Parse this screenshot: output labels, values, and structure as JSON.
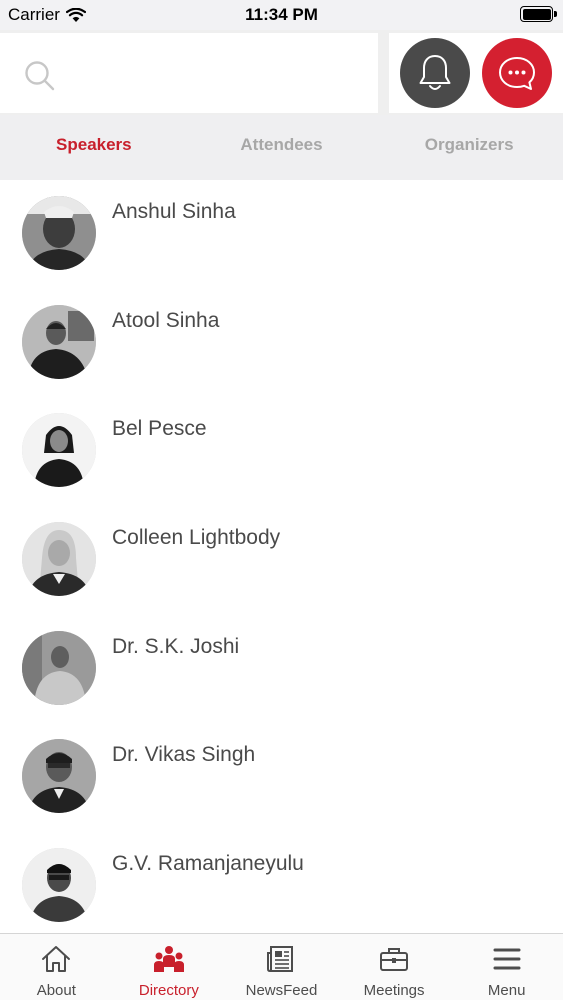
{
  "status": {
    "carrier": "Carrier",
    "time": "11:34 PM",
    "battery_level": 1.0
  },
  "search": {
    "icon": "search-icon"
  },
  "actions": {
    "notification_icon": "bell-icon",
    "chat_icon": "chat-bubble-icon",
    "accent_color": "#d42030",
    "dark_color": "#4a4a4a"
  },
  "tabs": [
    {
      "label": "Speakers",
      "active": true
    },
    {
      "label": "Attendees",
      "active": false
    },
    {
      "label": "Organizers",
      "active": false
    }
  ],
  "speakers": [
    {
      "name": "Anshul Sinha",
      "avatar": "avatar-photo"
    },
    {
      "name": "Atool Sinha",
      "avatar": "avatar-photo"
    },
    {
      "name": "Bel Pesce",
      "avatar": "avatar-photo"
    },
    {
      "name": "Colleen Lightbody",
      "avatar": "avatar-photo"
    },
    {
      "name": "Dr. S.K. Joshi",
      "avatar": "avatar-photo"
    },
    {
      "name": "Dr. Vikas Singh",
      "avatar": "avatar-photo"
    },
    {
      "name": "G.V. Ramanjaneyulu",
      "avatar": "avatar-photo"
    }
  ],
  "tab_bar": [
    {
      "label": "About",
      "icon": "home-icon",
      "active": false
    },
    {
      "label": "Directory",
      "icon": "people-icon",
      "active": true
    },
    {
      "label": "NewsFeed",
      "icon": "newspaper-icon",
      "active": false
    },
    {
      "label": "Meetings",
      "icon": "briefcase-icon",
      "active": false
    },
    {
      "label": "Menu",
      "icon": "hamburger-icon",
      "active": false
    }
  ]
}
